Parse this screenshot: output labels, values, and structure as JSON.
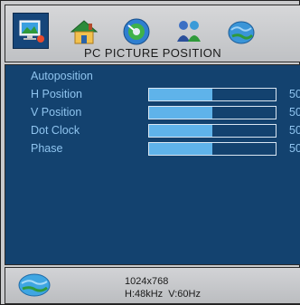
{
  "header": {
    "title": "PC PICTURE POSITION",
    "icons": [
      "pc-picture-icon",
      "home-icon",
      "disc-icon",
      "people-icon",
      "globe-icon"
    ]
  },
  "menu": {
    "items": [
      {
        "label": "Autoposition"
      },
      {
        "label": "H Position",
        "value": "50",
        "level": 0.5
      },
      {
        "label": "V Position",
        "value": "50",
        "level": 0.5
      },
      {
        "label": "Dot Clock",
        "value": "50",
        "level": 0.5
      },
      {
        "label": "Phase",
        "value": "50",
        "level": 0.5
      }
    ]
  },
  "footer": {
    "icon": "globe-icon",
    "resolution": "1024x768",
    "frequency": "H:48kHz  V:60Hz"
  },
  "colors": {
    "panel_bg": "#13426f",
    "label_text": "#8fc4ef",
    "bar_fill": "#5fb3ea",
    "frame_bg": "#c9cacc"
  }
}
